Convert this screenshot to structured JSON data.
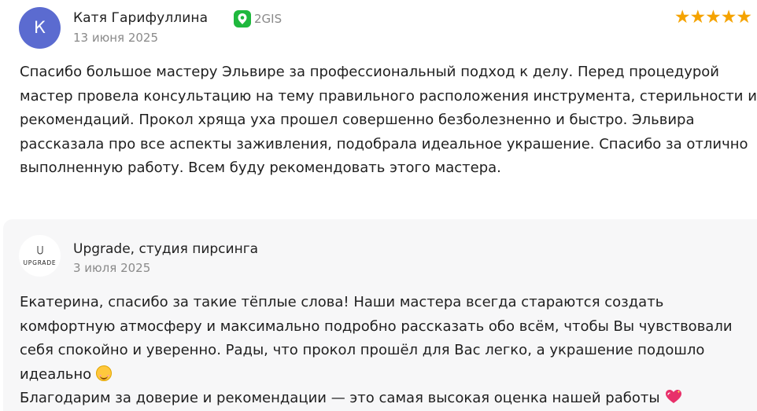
{
  "review": {
    "avatar_letter": "К",
    "author": "Катя Гарифуллина",
    "source": "2GIS",
    "date": "13 июня 2025",
    "rating_stars": "★★★★★",
    "rating": 5,
    "text": "Спасибо большое мастеру Эльвире за профессиональный подход к делу. Перед процедурой мастер провела консультацию на тему правильного расположения инструмента, стерильности и рекомендаций. Прокол хряща уха прошел совершенно безболезненно и быстро. Эльвира рассказала про все аспекты заживления, подобрала идеальное украшение. Спасибо за отлично выполненную работу. Всем буду рекомендовать этого мастера."
  },
  "reply": {
    "org_logo_text": "UPGRADE",
    "org_name": "Upgrade, студия пирсинга",
    "date": "3 июля 2025",
    "text_line1": "Екатерина, спасибо за такие тёплые слова! Наши мастера всегда стараются создать комфортную атмосферу и максимально подробно рассказать обо всём, чтобы Вы чувствовали себя спокойно и уверенно. Рады, что прокол прошёл для Вас легко, а украшение подошло идеально",
    "emoji1": "smiling-face-icon",
    "text_line2": "Благодарим за доверие и рекомендации — это самая высокая оценка нашей работы",
    "emoji2": "sparkling-heart-icon"
  },
  "colors": {
    "avatar_bg": "#5b6bd0",
    "star": "#f5a300",
    "source_green": "#1fb83d",
    "muted_text": "#8a8a8a",
    "reply_bg": "#f7f7f8"
  }
}
